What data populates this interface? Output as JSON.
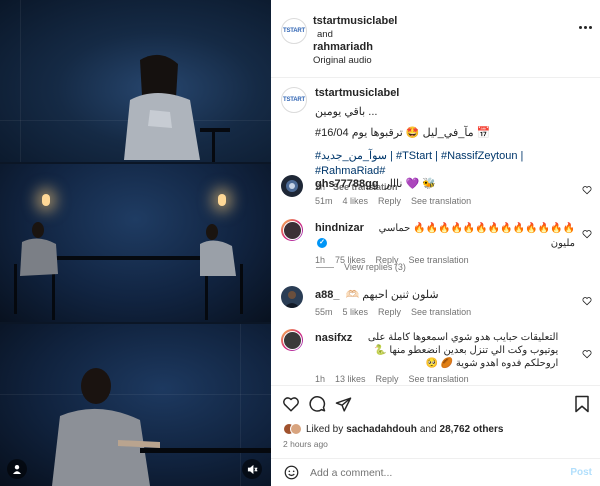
{
  "header": {
    "user1": "tstartmusiclabel",
    "joiner": "and",
    "user2": "rahmariadh",
    "audio": "Original audio"
  },
  "caption": {
    "username": "tstartmusiclabel",
    "line1": "باقي يومين ... ",
    "line2": "#مآ_في_ليل 🤩 ترقبوها يوم 16/04 📅",
    "line3": "#سوآ_من_جديد | #TStart | #NassifZeytoun | #RahmaRiad#",
    "time": "2h",
    "see_translation": "See translation"
  },
  "comments": [
    {
      "username": "ghs77788gg",
      "text": "🐝 💜 نااار",
      "time": "51m",
      "likes": "4 likes",
      "reply": "Reply",
      "see_translation": "See translation",
      "avatar_color": "#1e2736"
    },
    {
      "username": "hindnizar",
      "verified": true,
      "text": "🔥🔥🔥🔥🔥🔥🔥🔥🔥🔥🔥🔥🔥 حماسي مليون",
      "time": "1h",
      "likes": "75 likes",
      "reply": "Reply",
      "see_translation": "See translation",
      "view_replies": "View replies (3)",
      "avatar_color": "#3b2f36"
    },
    {
      "username": "a88_",
      "text": "شلون ثنين احبهم 🫶🏻",
      "time": "55m",
      "likes": "5 likes",
      "reply": "Reply",
      "see_translation": "See translation",
      "avatar_color": "#2a3d55"
    },
    {
      "username": "nasifxz",
      "text": "التعليقات حبايب هدو شوي اسمعوها كاملة على يوتيوب وكت الي تنزل بعدين انضعطو منها 🐍 اروحلكم فدوه اهدو شوية 🏉 🥺",
      "time": "1h",
      "likes": "13 likes",
      "reply": "Reply",
      "see_translation": "See translation",
      "avatar_color": "#3a3a3a"
    }
  ],
  "actions": {
    "liked_by_prefix": "Liked by",
    "liked_by_user": "sachadahdouh",
    "liked_by_and": "and",
    "liked_by_count": "28,762 others",
    "posted": "2 hours ago"
  },
  "add_comment": {
    "placeholder": "Add a comment...",
    "post_label": "Post"
  },
  "colors": {
    "accent_link": "#0095f6",
    "post_disabled": "#b2dffc",
    "secondary_text": "#737373"
  }
}
